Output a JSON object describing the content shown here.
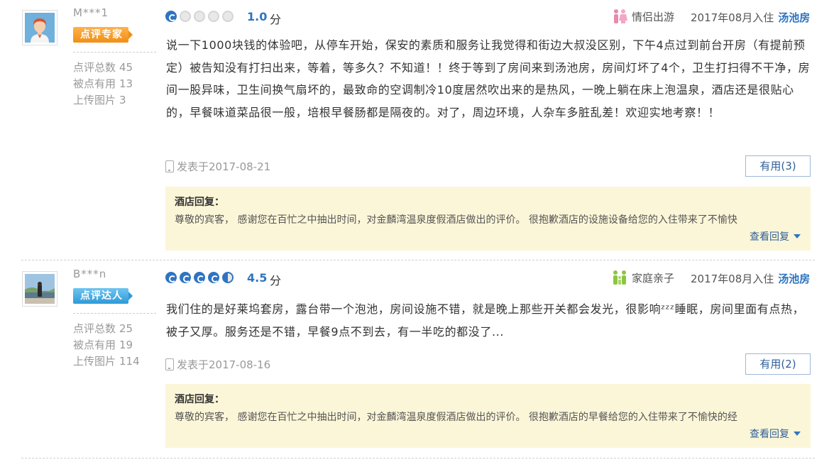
{
  "reviews": [
    {
      "user": {
        "name": "M***1",
        "badge": "点评专家",
        "stats": [
          {
            "label": "点评总数",
            "value": "45"
          },
          {
            "label": "被点有用",
            "value": "13"
          },
          {
            "label": "上传图片",
            "value": "3"
          }
        ]
      },
      "score": "1.0",
      "score_unit": "分",
      "stars_filled": 1,
      "stars_half": 0,
      "trip_type": "情侣出游",
      "checkin": "2017年08月入住",
      "room": "汤池房",
      "content": "说一下1000块钱的体验吧，从停车开始，保安的素质和服务让我觉得和街边大叔没区别，下午4点过到前台开房（有提前预定）被告知没有打扫出来，等着，等多久？不知道！！终于等到了房间来到汤池房，房间灯坏了4个，卫生打扫得不干净，房间一股异味，卫生间换气扇坏的，最致命的空调制冷10度居然吹出来的是热风，一晚上躺在床上泡温泉，酒店还是很贴心的，早餐味道菜品很一般，培根早餐肠都是隔夜的。对了，周边环境，人杂车多脏乱差！欢迎实地考察！！",
      "posted": "发表于2017-08-21",
      "useful": "有用(3)",
      "reply_title": "酒店回复：",
      "reply_text": "尊敬的宾客， 感谢您在百忙之中抽出时间，对金麟湾温泉度假酒店做出的评价。 很抱歉酒店的设施设备给您的入住带来了不愉快",
      "reply_more": "查看回复"
    },
    {
      "user": {
        "name": "B***n",
        "badge": "点评达人",
        "stats": [
          {
            "label": "点评总数",
            "value": "25"
          },
          {
            "label": "被点有用",
            "value": "19"
          },
          {
            "label": "上传图片",
            "value": "114"
          }
        ]
      },
      "score": "4.5",
      "score_unit": "分",
      "stars_filled": 4,
      "stars_half": 1,
      "trip_type": "家庭亲子",
      "checkin": "2017年08月入住",
      "room": "汤池房",
      "content": "我们住的是好莱坞套房，露台带一个泡池，房间设施不错，就是晚上那些开关都会发光，很影响ᶻᶻᶻ睡眠，房间里面有点热，被子又厚。服务还是不错，早餐9点不到去，有一半吃的都没了...",
      "posted": "发表于2017-08-16",
      "useful": "有用(2)",
      "reply_title": "酒店回复：",
      "reply_text": "尊敬的宾客， 感谢您在百忙之中抽出时间，对金麟湾温泉度假酒店做出的评价。 很抱歉酒店的早餐给您的入住带来了不愉快的经",
      "reply_more": "查看回复"
    }
  ],
  "colors": {
    "accent": "#2f74c0",
    "reply_bg": "#fbf6d8",
    "badge_expert": "#f08f16",
    "badge_master": "#2e9ad8"
  }
}
